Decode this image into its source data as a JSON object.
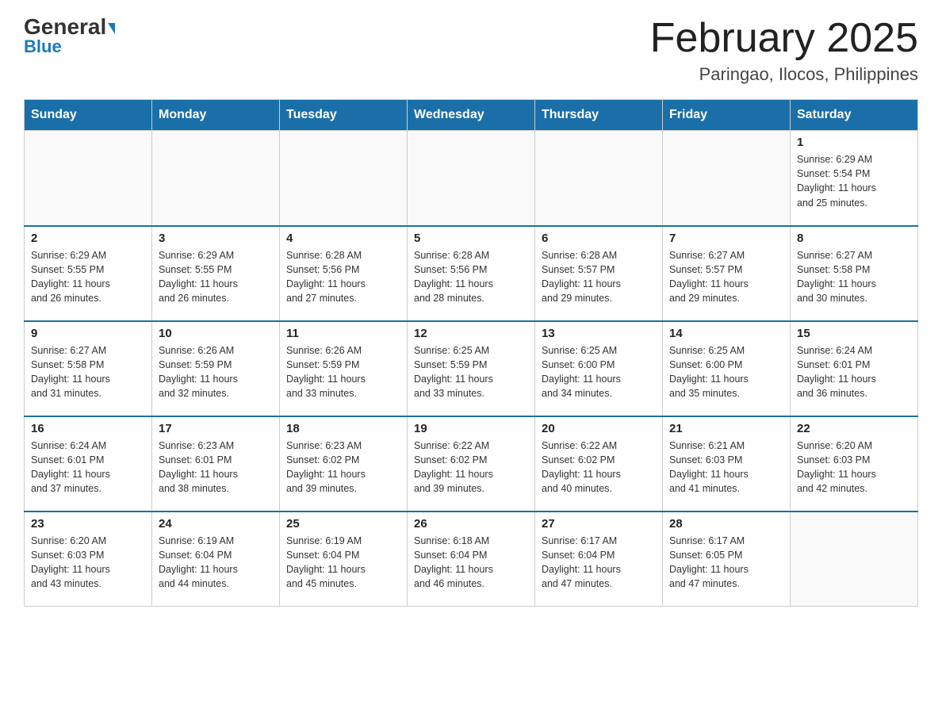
{
  "header": {
    "logo_general": "General",
    "logo_blue": "Blue",
    "month_title": "February 2025",
    "location": "Paringao, Ilocos, Philippines"
  },
  "weekdays": [
    "Sunday",
    "Monday",
    "Tuesday",
    "Wednesday",
    "Thursday",
    "Friday",
    "Saturday"
  ],
  "weeks": [
    [
      {
        "day": "",
        "info": ""
      },
      {
        "day": "",
        "info": ""
      },
      {
        "day": "",
        "info": ""
      },
      {
        "day": "",
        "info": ""
      },
      {
        "day": "",
        "info": ""
      },
      {
        "day": "",
        "info": ""
      },
      {
        "day": "1",
        "info": "Sunrise: 6:29 AM\nSunset: 5:54 PM\nDaylight: 11 hours\nand 25 minutes."
      }
    ],
    [
      {
        "day": "2",
        "info": "Sunrise: 6:29 AM\nSunset: 5:55 PM\nDaylight: 11 hours\nand 26 minutes."
      },
      {
        "day": "3",
        "info": "Sunrise: 6:29 AM\nSunset: 5:55 PM\nDaylight: 11 hours\nand 26 minutes."
      },
      {
        "day": "4",
        "info": "Sunrise: 6:28 AM\nSunset: 5:56 PM\nDaylight: 11 hours\nand 27 minutes."
      },
      {
        "day": "5",
        "info": "Sunrise: 6:28 AM\nSunset: 5:56 PM\nDaylight: 11 hours\nand 28 minutes."
      },
      {
        "day": "6",
        "info": "Sunrise: 6:28 AM\nSunset: 5:57 PM\nDaylight: 11 hours\nand 29 minutes."
      },
      {
        "day": "7",
        "info": "Sunrise: 6:27 AM\nSunset: 5:57 PM\nDaylight: 11 hours\nand 29 minutes."
      },
      {
        "day": "8",
        "info": "Sunrise: 6:27 AM\nSunset: 5:58 PM\nDaylight: 11 hours\nand 30 minutes."
      }
    ],
    [
      {
        "day": "9",
        "info": "Sunrise: 6:27 AM\nSunset: 5:58 PM\nDaylight: 11 hours\nand 31 minutes."
      },
      {
        "day": "10",
        "info": "Sunrise: 6:26 AM\nSunset: 5:59 PM\nDaylight: 11 hours\nand 32 minutes."
      },
      {
        "day": "11",
        "info": "Sunrise: 6:26 AM\nSunset: 5:59 PM\nDaylight: 11 hours\nand 33 minutes."
      },
      {
        "day": "12",
        "info": "Sunrise: 6:25 AM\nSunset: 5:59 PM\nDaylight: 11 hours\nand 33 minutes."
      },
      {
        "day": "13",
        "info": "Sunrise: 6:25 AM\nSunset: 6:00 PM\nDaylight: 11 hours\nand 34 minutes."
      },
      {
        "day": "14",
        "info": "Sunrise: 6:25 AM\nSunset: 6:00 PM\nDaylight: 11 hours\nand 35 minutes."
      },
      {
        "day": "15",
        "info": "Sunrise: 6:24 AM\nSunset: 6:01 PM\nDaylight: 11 hours\nand 36 minutes."
      }
    ],
    [
      {
        "day": "16",
        "info": "Sunrise: 6:24 AM\nSunset: 6:01 PM\nDaylight: 11 hours\nand 37 minutes."
      },
      {
        "day": "17",
        "info": "Sunrise: 6:23 AM\nSunset: 6:01 PM\nDaylight: 11 hours\nand 38 minutes."
      },
      {
        "day": "18",
        "info": "Sunrise: 6:23 AM\nSunset: 6:02 PM\nDaylight: 11 hours\nand 39 minutes."
      },
      {
        "day": "19",
        "info": "Sunrise: 6:22 AM\nSunset: 6:02 PM\nDaylight: 11 hours\nand 39 minutes."
      },
      {
        "day": "20",
        "info": "Sunrise: 6:22 AM\nSunset: 6:02 PM\nDaylight: 11 hours\nand 40 minutes."
      },
      {
        "day": "21",
        "info": "Sunrise: 6:21 AM\nSunset: 6:03 PM\nDaylight: 11 hours\nand 41 minutes."
      },
      {
        "day": "22",
        "info": "Sunrise: 6:20 AM\nSunset: 6:03 PM\nDaylight: 11 hours\nand 42 minutes."
      }
    ],
    [
      {
        "day": "23",
        "info": "Sunrise: 6:20 AM\nSunset: 6:03 PM\nDaylight: 11 hours\nand 43 minutes."
      },
      {
        "day": "24",
        "info": "Sunrise: 6:19 AM\nSunset: 6:04 PM\nDaylight: 11 hours\nand 44 minutes."
      },
      {
        "day": "25",
        "info": "Sunrise: 6:19 AM\nSunset: 6:04 PM\nDaylight: 11 hours\nand 45 minutes."
      },
      {
        "day": "26",
        "info": "Sunrise: 6:18 AM\nSunset: 6:04 PM\nDaylight: 11 hours\nand 46 minutes."
      },
      {
        "day": "27",
        "info": "Sunrise: 6:17 AM\nSunset: 6:04 PM\nDaylight: 11 hours\nand 47 minutes."
      },
      {
        "day": "28",
        "info": "Sunrise: 6:17 AM\nSunset: 6:05 PM\nDaylight: 11 hours\nand 47 minutes."
      },
      {
        "day": "",
        "info": ""
      }
    ]
  ]
}
